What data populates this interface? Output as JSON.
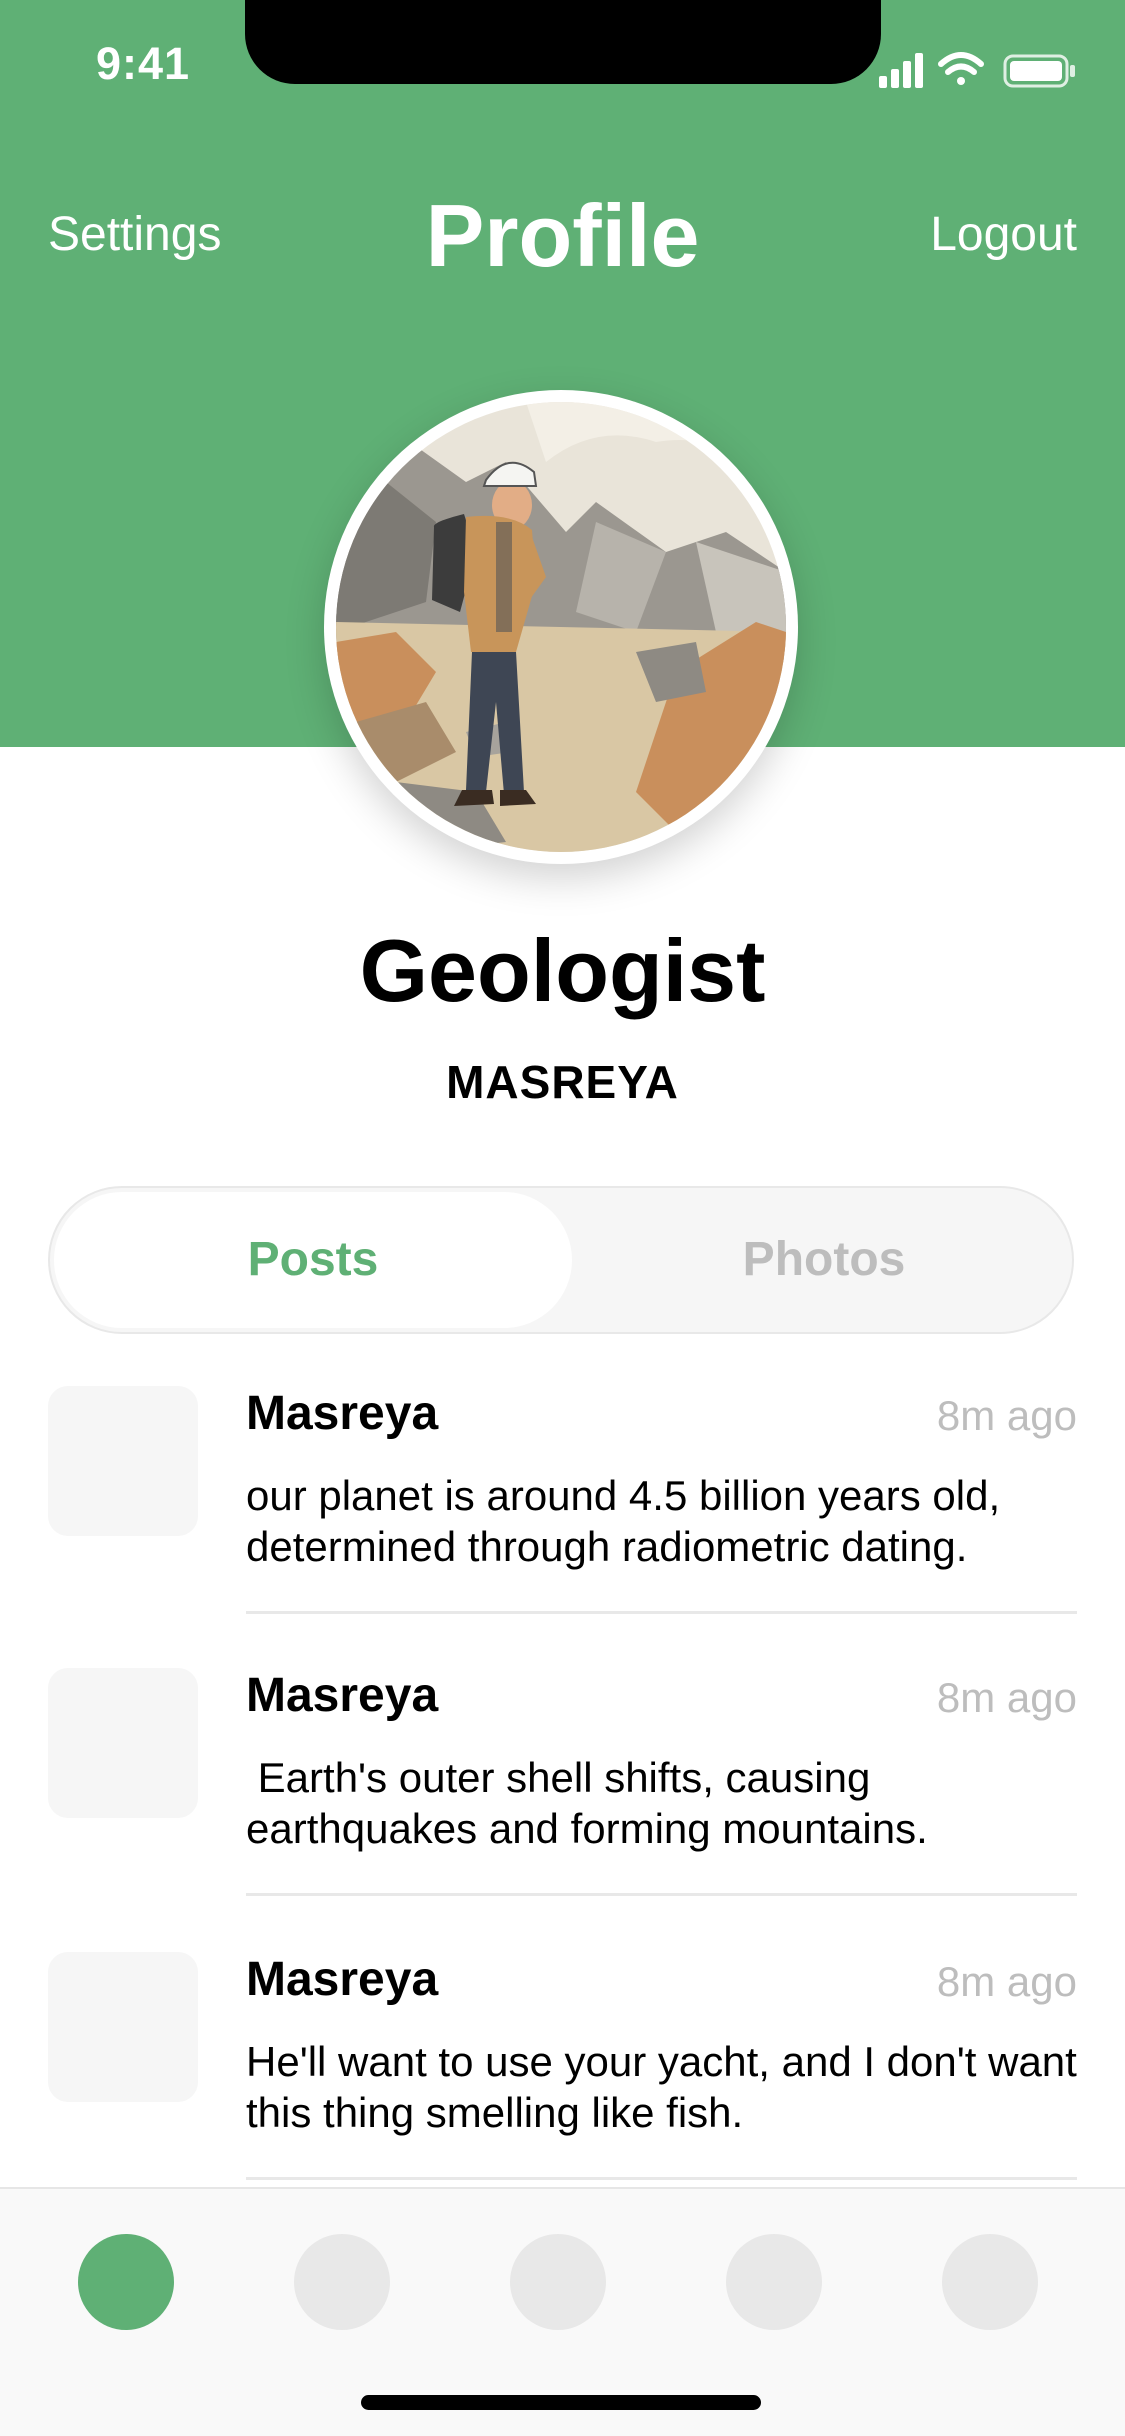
{
  "status_bar": {
    "time": "9:41"
  },
  "nav": {
    "left_label": "Settings",
    "title": "Profile",
    "right_label": "Logout"
  },
  "profile": {
    "name": "Geologist",
    "handle": "MASREYA"
  },
  "tabs": [
    {
      "label": "Posts",
      "selected": true
    },
    {
      "label": "Photos",
      "selected": false
    }
  ],
  "posts": [
    {
      "author": "Masreya",
      "time": "8m ago",
      "text": "our planet is around 4.5 billion years old, determined through radiometric dating."
    },
    {
      "author": "Masreya",
      "time": "8m ago",
      "text": " Earth's outer shell shifts, causing earthquakes and forming mountains."
    },
    {
      "author": "Masreya",
      "time": "8m ago",
      "text": "He'll want to use your yacht, and I don't want this thing smelling like fish."
    }
  ],
  "tab_bar": {
    "active_index": 0,
    "count": 5
  },
  "colors": {
    "accent": "#5fb075",
    "muted": "#bdbdbd",
    "surface": "#f6f6f6"
  },
  "icons": [
    "signal-icon",
    "wifi-icon",
    "battery-icon"
  ]
}
